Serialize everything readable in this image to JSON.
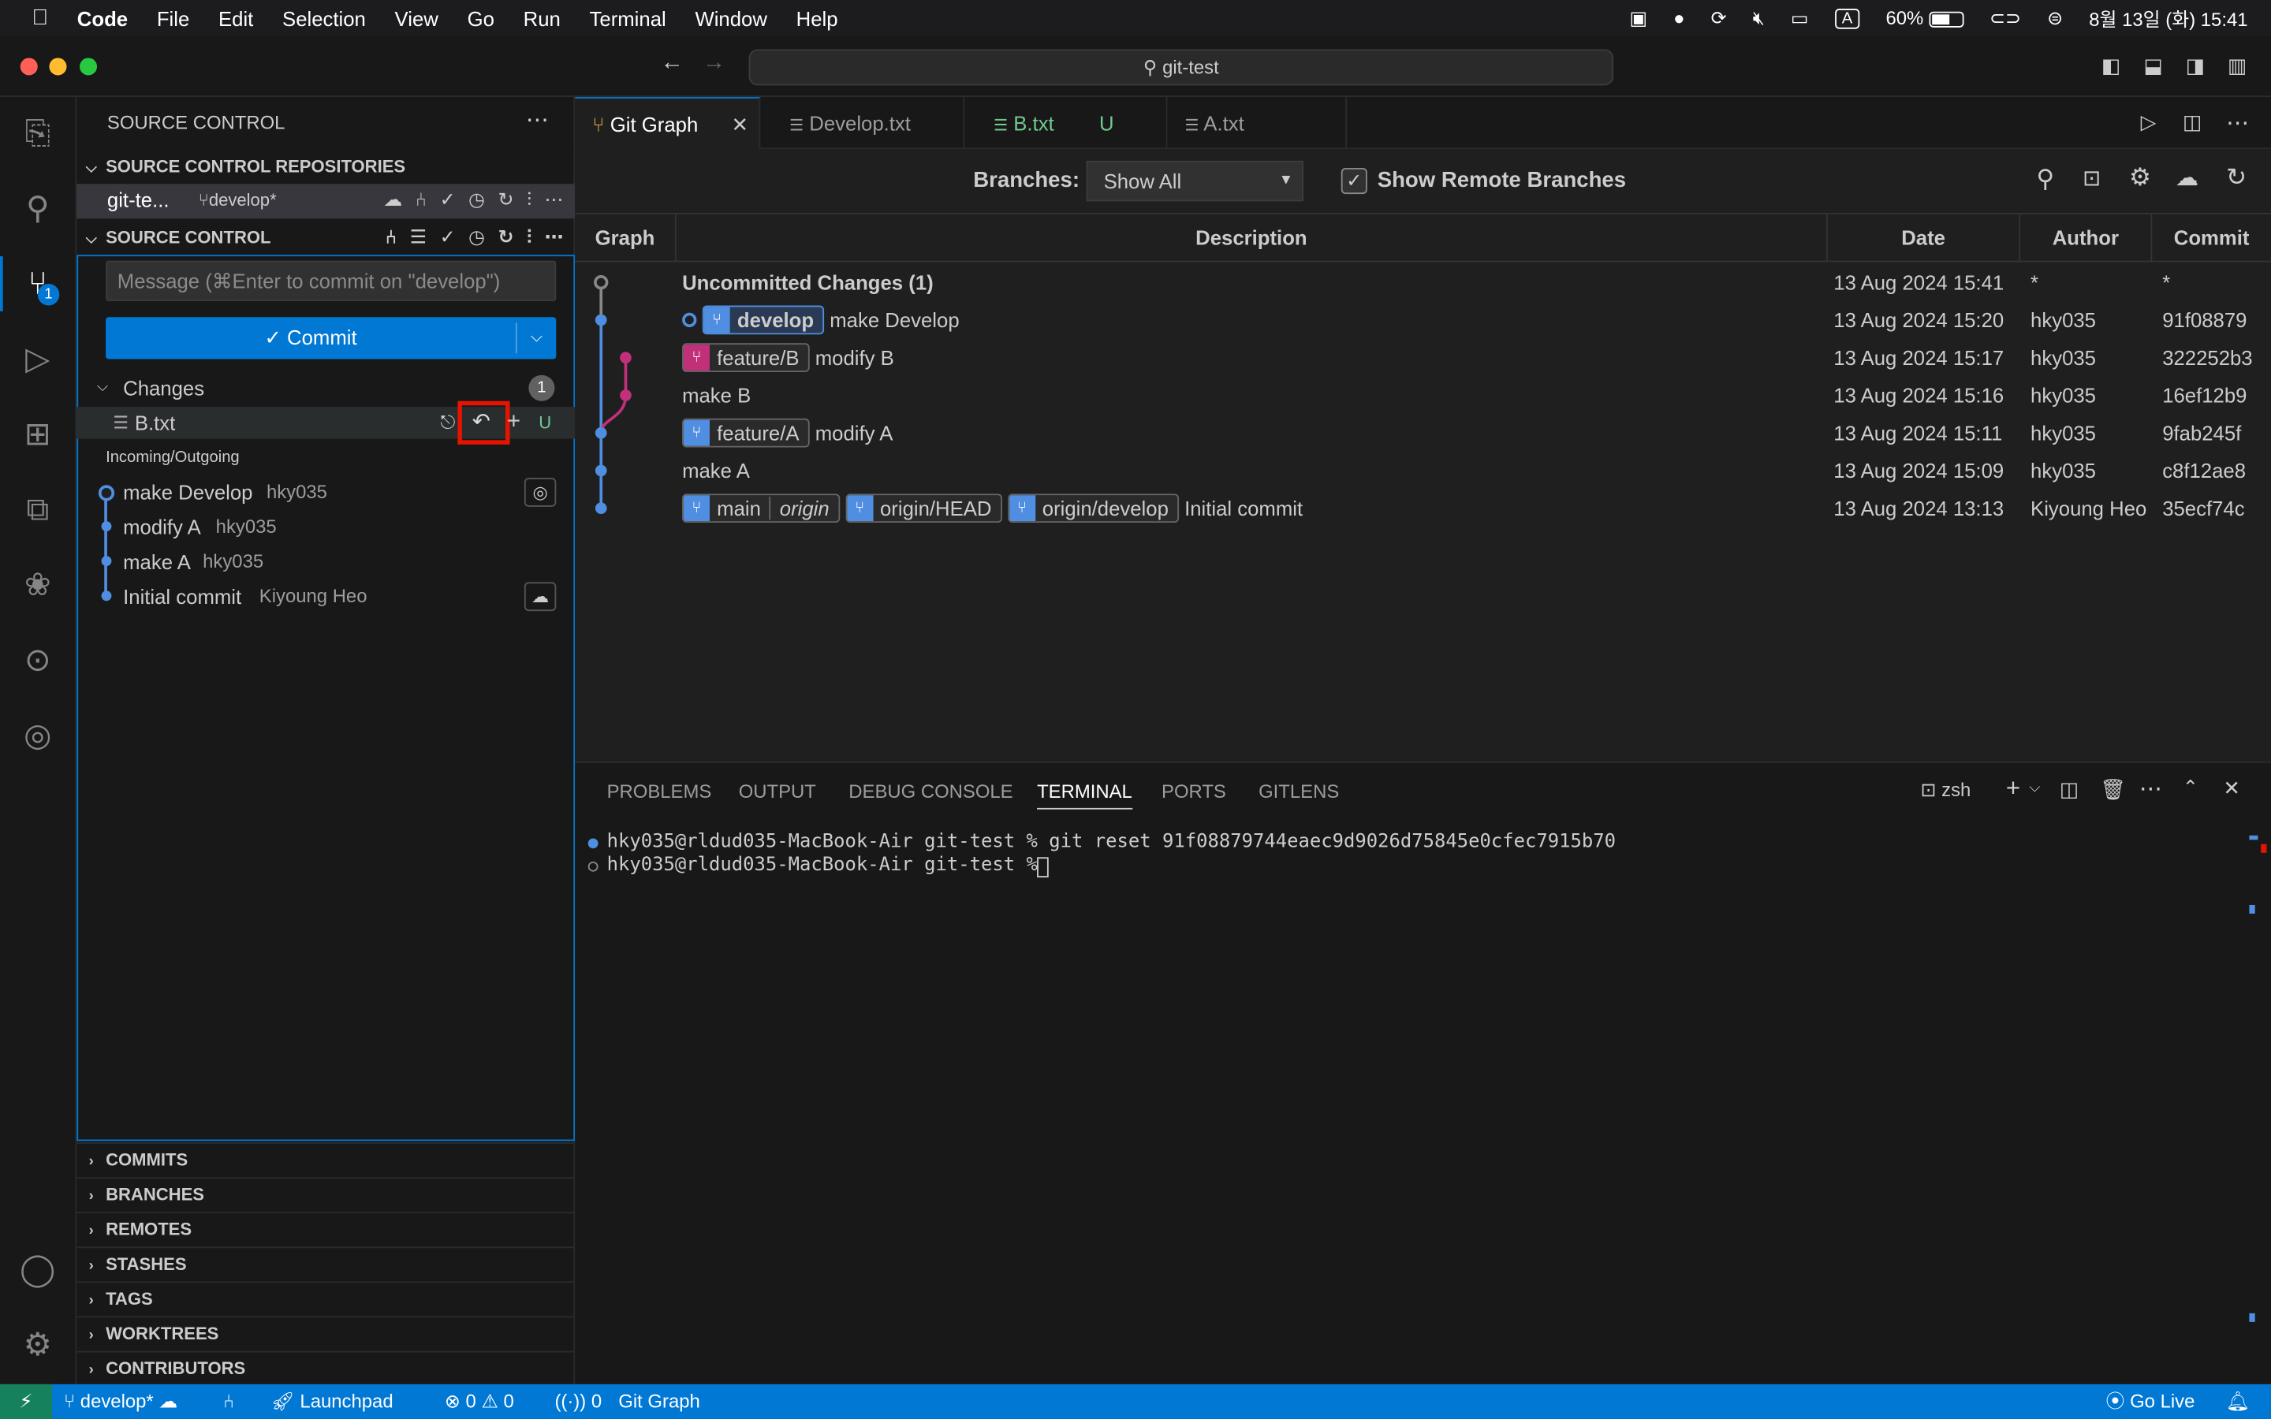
{
  "menubar": {
    "app": "Code",
    "items": [
      "File",
      "Edit",
      "Selection",
      "View",
      "Go",
      "Run",
      "Terminal",
      "Window",
      "Help"
    ],
    "battery": "60%",
    "clock": "8월 13일 (화) 15:41",
    "input_badge": "A"
  },
  "titlebar": {
    "search": "git-test"
  },
  "sidebar": {
    "title": "SOURCE CONTROL",
    "repos_header": "SOURCE CONTROL REPOSITORIES",
    "repo_name": "git-te...",
    "repo_branch": "develop*",
    "sc_header": "SOURCE CONTROL",
    "message_placeholder": "Message (⌘Enter to commit on \"develop\")",
    "commit_label": "✓ Commit",
    "changes_label": "Changes",
    "changes_count": "1",
    "file_name": "B.txt",
    "file_status": "U",
    "incoming_label": "Incoming/Outgoing",
    "history": [
      {
        "msg": "make Develop",
        "author": "hky035"
      },
      {
        "msg": "modify A",
        "author": "hky035"
      },
      {
        "msg": "make A",
        "author": "hky035"
      },
      {
        "msg": "Initial commit",
        "author": "Kiyoung Heo"
      }
    ],
    "sections": [
      "COMMITS",
      "BRANCHES",
      "REMOTES",
      "STASHES",
      "TAGS",
      "WORKTREES",
      "CONTRIBUTORS"
    ]
  },
  "activity_badge": "1",
  "tabs": [
    {
      "label": "Git Graph",
      "close": "✕"
    },
    {
      "label": "Develop.txt"
    },
    {
      "label": "B.txt",
      "status": "U"
    },
    {
      "label": "A.txt"
    }
  ],
  "gitgraph": {
    "branches_label": "Branches:",
    "branches_value": "Show All",
    "remote_label": "Show Remote Branches",
    "columns": [
      "Graph",
      "Description",
      "Date",
      "Author",
      "Commit"
    ],
    "rows": [
      {
        "desc": "Uncommitted Changes (1)",
        "date": "13 Aug 2024 15:41",
        "author": "*",
        "hash": "*"
      },
      {
        "ref": "develop",
        "desc": "make Develop",
        "date": "13 Aug 2024 15:20",
        "author": "hky035",
        "hash": "91f08879"
      },
      {
        "ref": "feature/B",
        "desc": "modify B",
        "date": "13 Aug 2024 15:17",
        "author": "hky035",
        "hash": "322252b3"
      },
      {
        "desc": "make B",
        "date": "13 Aug 2024 15:16",
        "author": "hky035",
        "hash": "16ef12b9"
      },
      {
        "ref": "feature/A",
        "desc": "modify A",
        "date": "13 Aug 2024 15:11",
        "author": "hky035",
        "hash": "9fab245f"
      },
      {
        "desc": "make A",
        "date": "13 Aug 2024 15:09",
        "author": "hky035",
        "hash": "c8f12ae8"
      },
      {
        "ref": "main",
        "remote": "origin",
        "ref2": "origin/HEAD",
        "ref3": "origin/develop",
        "desc": "Initial commit",
        "date": "13 Aug 2024 13:13",
        "author": "Kiyoung Heo",
        "hash": "35ecf74c"
      }
    ]
  },
  "panel": {
    "tabs": [
      "PROBLEMS",
      "OUTPUT",
      "DEBUG CONSOLE",
      "TERMINAL",
      "PORTS",
      "GITLENS"
    ],
    "shell": "zsh",
    "lines": [
      "hky035@rldud035-MacBook-Air git-test % git reset 91f08879744eaec9d9026d75845e0cfec7915b70",
      "hky035@rldud035-MacBook-Air git-test % "
    ]
  },
  "status": {
    "branch": "develop*",
    "launchpad": "Launchpad",
    "errors": "0",
    "warnings": "0",
    "ports": "0",
    "gitgraph": "Git Graph",
    "golive": "Go Live"
  },
  "colors": {
    "accent": "#0078d4",
    "feature_b": "#c2307a",
    "highlight": "#e51400"
  }
}
